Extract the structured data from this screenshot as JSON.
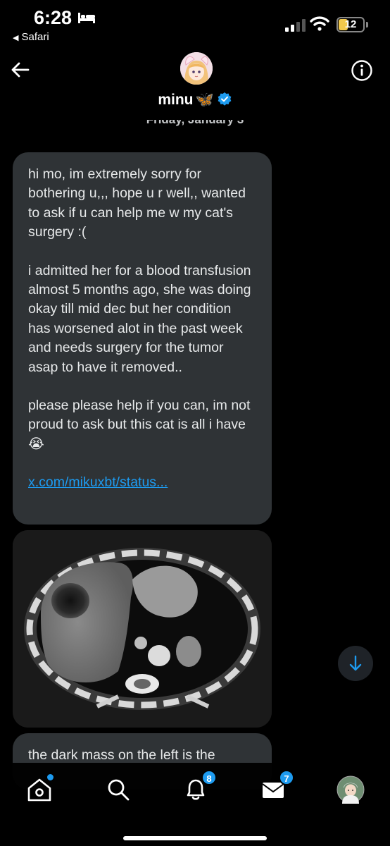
{
  "status_bar": {
    "time": "6:28",
    "back_app": "Safari",
    "battery": "12"
  },
  "header": {
    "name": "minu",
    "name_emoji": "🦋",
    "date": "Friday, January 3"
  },
  "messages": [
    {
      "paragraphs": [
        "hi mo, im extremely sorry for bothering u,,, hope u r well,, wanted to ask if u can help me w my cat's surgery :(",
        "i admitted her for a blood transfusion almost 5 months ago, she was doing okay till mid dec but her condition has worsened alot in the past week and needs surgery for the tumor asap to have it removed..",
        "please please help if you can, im not proud to ask but this cat is all i have😭"
      ],
      "link": "x.com/mikuxbt/status..."
    },
    {
      "image": "ct-scan"
    },
    {
      "text": "the dark mass on the left is the"
    }
  ],
  "nav": {
    "notifications_badge": "8",
    "messages_badge": "7"
  },
  "colors": {
    "accent": "#1d9bf0",
    "bubble": "#2f3336",
    "background": "#000000"
  }
}
